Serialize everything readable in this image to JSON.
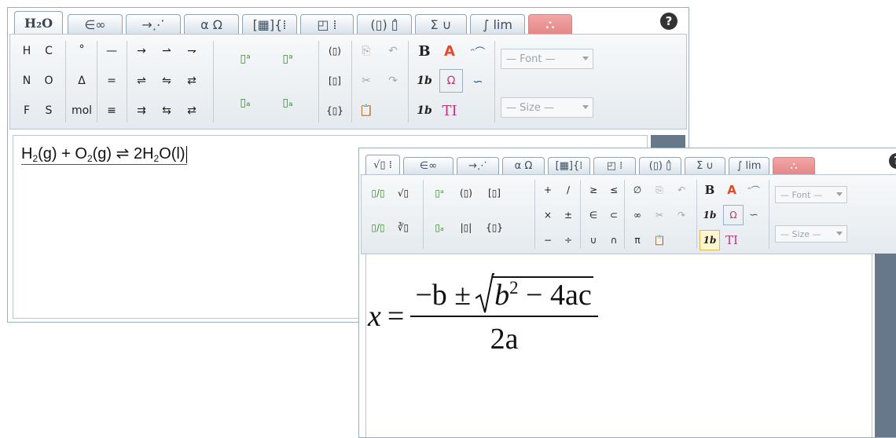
{
  "windowA": {
    "tabs": [
      "H₂O",
      "∈∞",
      "→⋰",
      "α Ω",
      "[▦]{⁞",
      "◰ ⁞",
      "(▯) ▯̂",
      "Σ ∪",
      "∫ lim",
      "⛬"
    ],
    "help_label": "?",
    "toolbar": {
      "group_elements": [
        "H",
        "C",
        "N",
        "O",
        "F",
        "S"
      ],
      "group_symbols": [
        "°",
        "Δ",
        "mol"
      ],
      "group_bonds": [
        "—",
        "=",
        "≡"
      ],
      "group_arrows": [
        "→",
        "⇀",
        "⇁",
        "⇌",
        "⇋",
        "⇄",
        "⇉",
        "⇆",
        "⇄"
      ],
      "group_brackets": [
        "(▯)",
        "[▯]",
        "{▯}"
      ],
      "group_edit": [
        "⎘",
        "↶",
        "✂",
        "↷",
        "📋"
      ],
      "bold_label": "B",
      "italic_label": "1b",
      "italic_label2": "1b",
      "font_text_label": "TI",
      "font_dropdown": "— Font —",
      "size_dropdown": "— Size —"
    },
    "equation": {
      "parts": [
        "H",
        "2",
        "(g) + O",
        "2",
        "(g) ⇌ 2H",
        "2",
        "O(l)"
      ]
    }
  },
  "windowB": {
    "tabs": [
      "√▯ ⁞",
      "∈∞",
      "→⋰",
      "α Ω",
      "[▦]{⁞",
      "◰ ⁞",
      "(▯) ▯̂",
      "Σ ∪",
      "∫ lim",
      "⛬"
    ],
    "help_label": "?",
    "toolbar": {
      "group_frac": [
        "▯/▯",
        "√▯",
        "▯/▯",
        "∛▯"
      ],
      "group_scripts": [
        "▯ᵃ",
        "(▯)",
        "[▯]",
        "▯ₐ",
        "|▯|",
        "{▯}"
      ],
      "group_ops": [
        "+",
        "/",
        "≥",
        "≤",
        "∅",
        "×",
        "±",
        "∈",
        "⊂",
        "∞",
        "−",
        "÷",
        "∪",
        "∩",
        "π"
      ],
      "bold_label": "B",
      "italic_label": "1b",
      "italic_label2": "1b",
      "font_text_label": "TI",
      "font_dropdown": "— Font —",
      "size_dropdown": "— Size —"
    },
    "formula": {
      "lhs": "x",
      "eq": "=",
      "minus_b": "−b ±",
      "radicand_b": "b",
      "exp": "2",
      "radicand_rest": " − 4ac",
      "den": "2a"
    }
  }
}
